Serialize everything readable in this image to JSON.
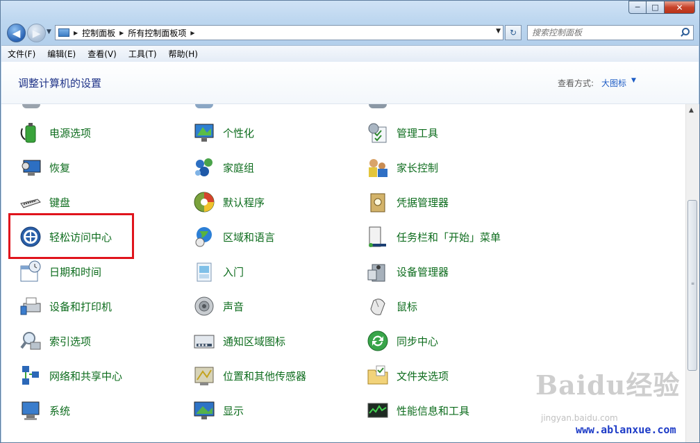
{
  "window": {
    "caption": {
      "minimize": "─",
      "maximize": "□",
      "close": "✕"
    }
  },
  "nav": {
    "back_glyph": "◀",
    "forward_glyph": "▶",
    "recent_glyph": "▼",
    "breadcrumb": [
      "控制面板",
      "所有控制面板项"
    ],
    "refresh_glyph": "↻"
  },
  "search": {
    "placeholder": "搜索控制面板"
  },
  "menu": [
    "文件(F)",
    "编辑(E)",
    "查看(V)",
    "工具(T)",
    "帮助(H)"
  ],
  "header": {
    "title": "调整计算机的设置",
    "view_label": "查看方式:",
    "view_value": "大图标",
    "view_caret": "▼"
  },
  "items": [
    {
      "label": "电源选项",
      "icon": "power-options-icon"
    },
    {
      "label": "个性化",
      "icon": "personalization-icon"
    },
    {
      "label": "管理工具",
      "icon": "admin-tools-icon"
    },
    {
      "label": "恢复",
      "icon": "recovery-icon"
    },
    {
      "label": "家庭组",
      "icon": "homegroup-icon"
    },
    {
      "label": "家长控制",
      "icon": "parental-controls-icon"
    },
    {
      "label": "键盘",
      "icon": "keyboard-icon"
    },
    {
      "label": "默认程序",
      "icon": "default-programs-icon"
    },
    {
      "label": "凭据管理器",
      "icon": "credential-manager-icon"
    },
    {
      "label": "轻松访问中心",
      "icon": "ease-of-access-icon"
    },
    {
      "label": "区域和语言",
      "icon": "region-language-icon"
    },
    {
      "label": "任务栏和「开始」菜单",
      "icon": "taskbar-start-menu-icon"
    },
    {
      "label": "日期和时间",
      "icon": "date-time-icon"
    },
    {
      "label": "入门",
      "icon": "getting-started-icon"
    },
    {
      "label": "设备管理器",
      "icon": "device-manager-icon"
    },
    {
      "label": "设备和打印机",
      "icon": "devices-printers-icon"
    },
    {
      "label": "声音",
      "icon": "sound-icon"
    },
    {
      "label": "鼠标",
      "icon": "mouse-icon"
    },
    {
      "label": "索引选项",
      "icon": "indexing-options-icon"
    },
    {
      "label": "通知区域图标",
      "icon": "notification-area-icon"
    },
    {
      "label": "同步中心",
      "icon": "sync-center-icon"
    },
    {
      "label": "网络和共享中心",
      "icon": "network-sharing-icon"
    },
    {
      "label": "位置和其他传感器",
      "icon": "location-sensors-icon"
    },
    {
      "label": "文件夹选项",
      "icon": "folder-options-icon"
    },
    {
      "label": "系统",
      "icon": "system-icon"
    },
    {
      "label": "显示",
      "icon": "display-icon"
    },
    {
      "label": "性能信息和工具",
      "icon": "performance-icon"
    }
  ],
  "highlighted_item": "轻松访问中心",
  "accent_colors": {
    "link": "#0d6c1d",
    "title": "#1e3287",
    "highlight": "#e0141c"
  },
  "watermark": {
    "brand": "Baidu经验",
    "sub": "jingyan.baidu.com",
    "url": "www.ablanxue.com"
  }
}
